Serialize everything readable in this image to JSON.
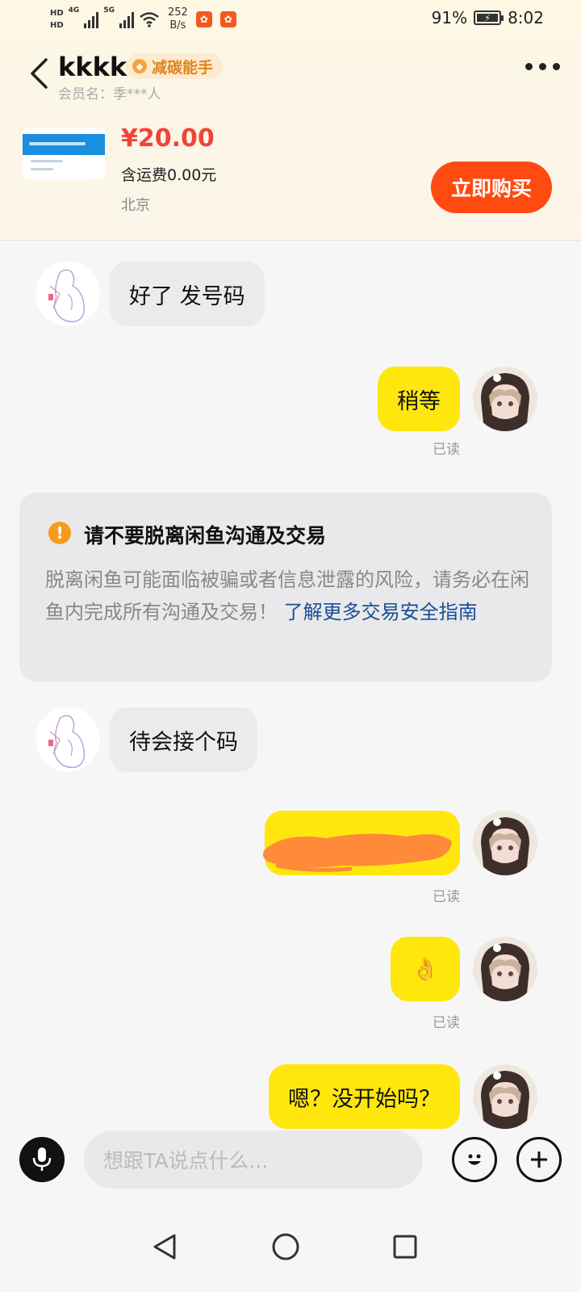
{
  "status_bar": {
    "hd1": "HD",
    "hd2": "HD",
    "network1": "4G",
    "network2": "5G",
    "speed_value": "252",
    "speed_unit": "B/s",
    "battery": "91%",
    "time": "8:02"
  },
  "header": {
    "title": "kkkk",
    "badge": "减碳能手",
    "member": "会员名：季***人"
  },
  "product": {
    "price": "¥20.00",
    "shipping": "含运费0.00元",
    "location": "北京",
    "buy_label": "立即购买"
  },
  "messages": [
    {
      "side": "left",
      "text": "好了 发号码"
    },
    {
      "side": "right",
      "text": "稍等",
      "status": "已读"
    },
    {
      "side": "left",
      "text": "待会接个码"
    },
    {
      "side": "right",
      "text": "",
      "status": "已读",
      "note": "redacted"
    },
    {
      "side": "right",
      "text": "👌",
      "status": "已读"
    },
    {
      "side": "right",
      "text": "嗯？没开始吗？"
    }
  ],
  "notice": {
    "title": "请不要脱离闲鱼沟通及交易",
    "body": "脱离闲鱼可能面临被骗或者信息泄露的风险，请务必在闲鱼内完成所有沟通及交易！",
    "link": "了解更多交易安全指南"
  },
  "input": {
    "placeholder": "想跟TA说点什么..."
  },
  "icons": {
    "back": "back-icon",
    "more": "more-icon",
    "voice": "microphone-icon",
    "emoji": "smiley-icon",
    "add": "plus-icon",
    "nav_back": "triangle-back-icon",
    "nav_home": "circle-home-icon",
    "nav_recents": "square-recents-icon"
  },
  "colors": {
    "price": "#f14436",
    "buy_button": "#ff4a12",
    "my_bubble": "#ffe70d",
    "their_bubble": "#ebebed",
    "badge_text": "#e0841c",
    "link": "#1a4f96"
  }
}
